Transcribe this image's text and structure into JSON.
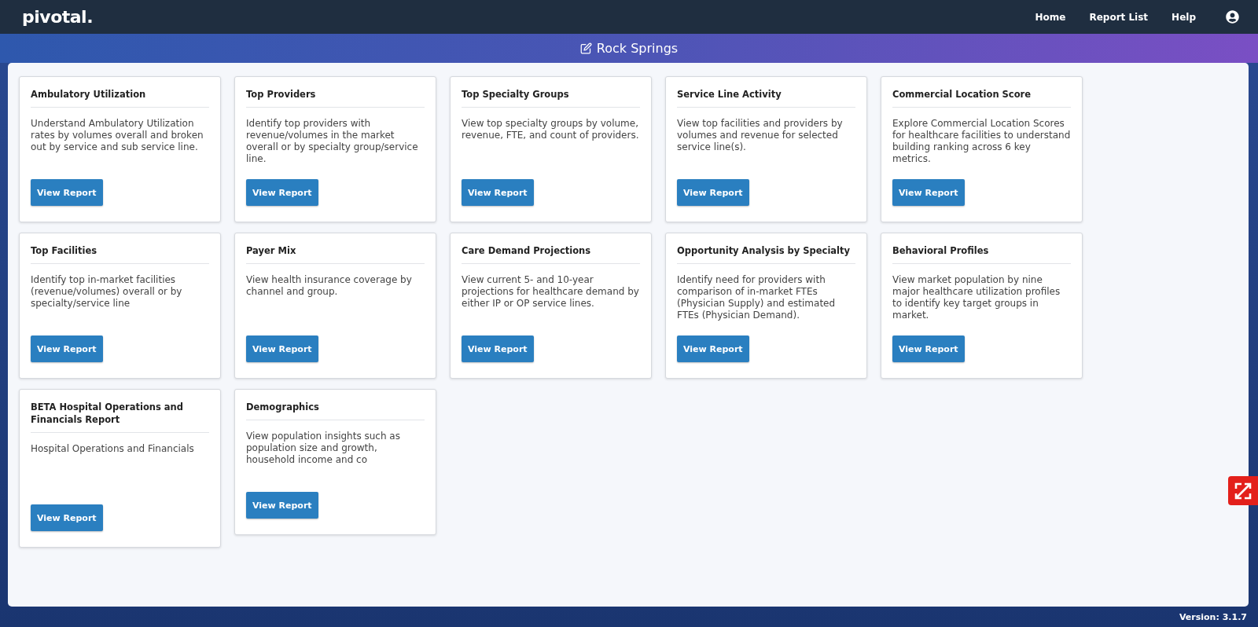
{
  "header": {
    "logo": "pivotal.",
    "nav": [
      "Home",
      "Report List",
      "Help"
    ]
  },
  "banner": {
    "title": "Rock Springs"
  },
  "reports": [
    {
      "title": "Ambulatory Utilization",
      "description": "Understand Ambulatory Utilization rates by volumes overall and broken out by service and sub service line.",
      "button": "View Report"
    },
    {
      "title": "Top Providers",
      "description": "Identify top providers with revenue/volumes in the market overall or by specialty group/service line.",
      "button": "View Report"
    },
    {
      "title": "Top Specialty Groups",
      "description": "View top specialty groups by volume, revenue, FTE, and count of providers.",
      "button": "View Report"
    },
    {
      "title": "Service Line Activity",
      "description": "View top facilities and providers by volumes and revenue for selected service line(s).",
      "button": "View Report"
    },
    {
      "title": "Commercial Location Score",
      "description": "Explore Commercial Location Scores for healthcare facilities to understand building ranking across 6 key metrics.",
      "button": "View Report"
    },
    {
      "title": "Top Facilities",
      "description": "Identify top in-market facilities (revenue/volumes) overall or by specialty/service line",
      "button": "View Report"
    },
    {
      "title": "Payer Mix",
      "description": "View health insurance coverage by channel and group.",
      "button": "View Report"
    },
    {
      "title": "Care Demand Projections",
      "description": "View current 5- and 10-year projections for healthcare demand by either IP or OP service lines.",
      "button": "View Report"
    },
    {
      "title": "Opportunity Analysis by Specialty",
      "description": "Identify need for providers with comparison of in-market FTEs (Physician Supply) and estimated FTEs (Physician Demand).",
      "button": "View Report"
    },
    {
      "title": "Behavioral Profiles",
      "description": "View market population by nine major healthcare utilization profiles to identify key target groups in market.",
      "button": "View Report"
    },
    {
      "title": "BETA Hospital Operations and Financials Report",
      "description": "Hospital Operations and Financials",
      "button": "View Report"
    },
    {
      "title": "Demographics",
      "description": "View population insights such as population size and growth, household income and co",
      "button": "View Report"
    }
  ],
  "footer": {
    "version": "Version: 3.1.7"
  }
}
